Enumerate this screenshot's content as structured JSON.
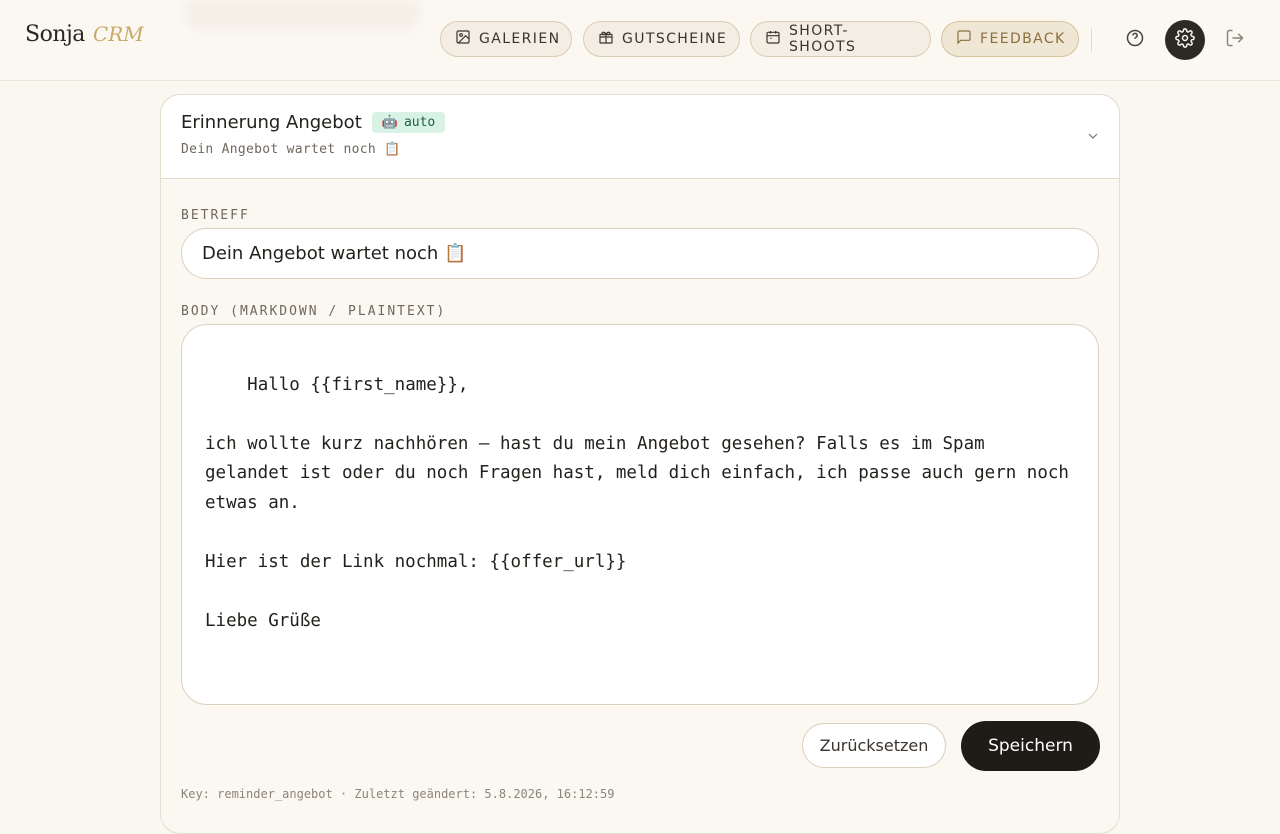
{
  "brand": {
    "name": "Sonja",
    "sub": "CRM"
  },
  "nav": {
    "items": [
      {
        "label": "GALERIEN",
        "icon": "image-icon"
      },
      {
        "label": "GUTSCHEINE",
        "icon": "gift-icon"
      },
      {
        "label": "SHORT-SHOOTS",
        "icon": "calendar-icon"
      },
      {
        "label": "FEEDBACK",
        "icon": "message-icon"
      }
    ],
    "help_icon": "help-circle-icon",
    "settings_icon": "gear-icon",
    "logout_icon": "logout-icon"
  },
  "template": {
    "title": "Erinnerung Angebot",
    "badge": "auto",
    "badge_icon": "robot-icon",
    "subtitle": "Dein Angebot wartet noch 📋",
    "subject_label": "BETREFF",
    "subject_value": "Dein Angebot wartet noch 📋",
    "body_label": "BODY (MARKDOWN / PLAINTEXT)",
    "body_value": "Hallo {{first_name}},\n\nich wollte kurz nachhören — hast du mein Angebot gesehen? Falls es im Spam gelandet ist oder du noch Fragen hast, meld dich einfach, ich passe auch gern noch etwas an.\n\nHier ist der Link nochmal: {{offer_url}}\n\nLiebe Grüße",
    "reset_label": "Zurücksetzen",
    "save_label": "Speichern",
    "meta": "Key: reminder_angebot · Zuletzt geändert: 5.8.2026, 16:12:59"
  },
  "colors": {
    "background": "#faf7f1",
    "accent_gold": "#c9a96a",
    "badge_bg": "#d8f3e6",
    "primary_button": "#1f1b17"
  }
}
